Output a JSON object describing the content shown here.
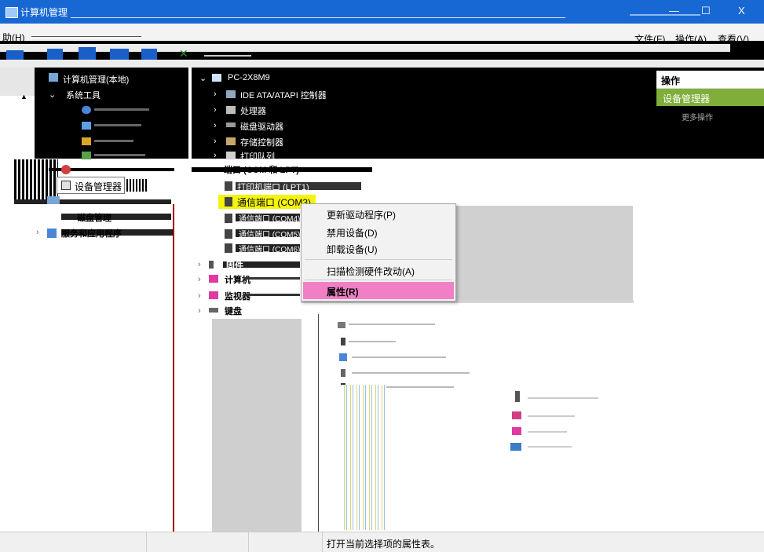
{
  "window": {
    "title": "计算机管理",
    "min": "—",
    "max": "☐",
    "close": "X"
  },
  "menubar": {
    "left_fragment": "助(H)",
    "items": [
      "文件(F)",
      "操作(A)",
      "查看(V)"
    ]
  },
  "left_tree": {
    "root": "计算机管理(本地)",
    "system_tools": "系统工具",
    "device_manager_tooltip": "设备管理器",
    "storage": "磁盘管理",
    "services": "服务和应用程序"
  },
  "device_tree": {
    "computer": "PC-2X8M9",
    "visible_items": [
      "IDE ATA/ATAPI 控制器",
      "处理器",
      "磁盘驱动器",
      "存储控制器",
      "打印队列",
      "端口 (COM 和 LPT)"
    ],
    "ports": [
      "打印机端口 (LPT1)",
      "通信端口 (COM3)",
      "通信端口 (COM4)",
      "通信端口 (COM5)",
      "通信端口 (COM6)"
    ],
    "selected_port": "通信端口 (COM3)",
    "after_ports": [
      "固件",
      "计算机",
      "监视器",
      "键盘"
    ]
  },
  "context_menu": {
    "items": [
      "更新驱动程序(P)",
      "禁用设备(D)",
      "卸载设备(U)",
      "扫描检测硬件改动(A)",
      "属性(R)"
    ]
  },
  "actions_pane": {
    "header": "操作",
    "section": "设备管理器",
    "more": "更多操作"
  },
  "status_bar": {
    "text": "打开当前选择项的属性表。"
  },
  "colors": {
    "titlebar": "#1868d4",
    "selection": "#f4f40c",
    "context_highlight": "#f07fc6",
    "actions_section": "#7fae3a"
  }
}
